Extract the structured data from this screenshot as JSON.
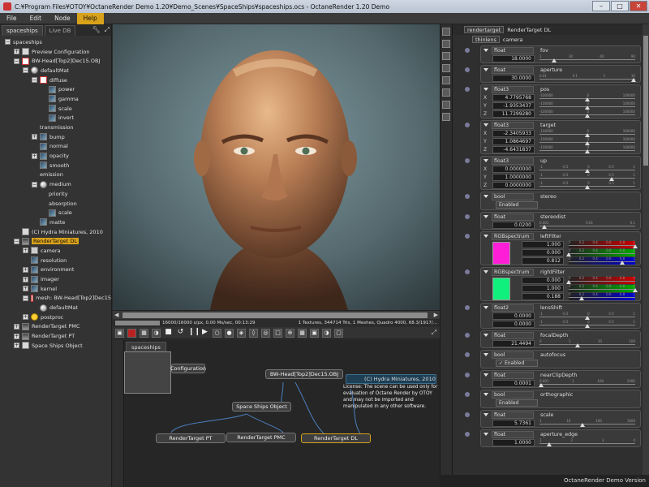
{
  "window": {
    "title": "C:¥Program Files¥OTOY¥OctaneRender Demo 1.20¥Demo_Scenes¥SpaceShips¥spaceships.ocs - OctaneRender 1.20 Demo",
    "minimize": "–",
    "maximize": "□",
    "close": "✕"
  },
  "menu": {
    "file": "File",
    "edit": "Edit",
    "node": "Node",
    "help": "Help"
  },
  "scene": {
    "tab_active": "spaceships",
    "tab_inactive": "Live DB",
    "tree": [
      {
        "label": "spaceships",
        "indent": 0,
        "exp": "-",
        "icon": "none"
      },
      {
        "label": "Preview Configuration",
        "indent": 1,
        "exp": "+",
        "icon": "doc"
      },
      {
        "label": "BW-Head[Top2]Dec15.OBJ",
        "indent": 1,
        "exp": "-",
        "icon": "red"
      },
      {
        "label": "defaultMat",
        "indent": 2,
        "exp": "-",
        "icon": "ball"
      },
      {
        "label": "diffuse",
        "indent": 3,
        "exp": "-",
        "icon": "red"
      },
      {
        "label": "power",
        "indent": 4,
        "exp": "",
        "icon": "tex"
      },
      {
        "label": "gamma",
        "indent": 4,
        "exp": "",
        "icon": "tex"
      },
      {
        "label": "scale",
        "indent": 4,
        "exp": "",
        "icon": "tex"
      },
      {
        "label": "invert",
        "indent": 4,
        "exp": "",
        "icon": "tex"
      },
      {
        "label": "transmission",
        "indent": 3,
        "exp": "",
        "icon": "none"
      },
      {
        "label": "bump",
        "indent": 3,
        "exp": "+",
        "icon": "tex"
      },
      {
        "label": "normal",
        "indent": 3,
        "exp": "",
        "icon": "tex"
      },
      {
        "label": "opacity",
        "indent": 3,
        "exp": "+",
        "icon": "tex"
      },
      {
        "label": "smooth",
        "indent": 3,
        "exp": "",
        "icon": "tex"
      },
      {
        "label": "emission",
        "indent": 3,
        "exp": "",
        "icon": "none"
      },
      {
        "label": "medium",
        "indent": 3,
        "exp": "-",
        "icon": "ball"
      },
      {
        "label": "priority",
        "indent": 4,
        "exp": "",
        "icon": "none"
      },
      {
        "label": "absorption",
        "indent": 4,
        "exp": "",
        "icon": "none"
      },
      {
        "label": "scale",
        "indent": 4,
        "exp": "",
        "icon": "tex"
      },
      {
        "label": "matte",
        "indent": 3,
        "exp": "",
        "icon": "tex"
      },
      {
        "label": "(C) Hydra Miniatures, 2010",
        "indent": 1,
        "exp": "",
        "icon": "doc"
      },
      {
        "label": "RenderTarget DL",
        "indent": 1,
        "exp": "-",
        "icon": "rt",
        "selected": true
      },
      {
        "label": "camera",
        "indent": 2,
        "exp": "+",
        "icon": "cam"
      },
      {
        "label": "resolution",
        "indent": 2,
        "exp": "",
        "icon": "tex"
      },
      {
        "label": "environment",
        "indent": 2,
        "exp": "+",
        "icon": "tex"
      },
      {
        "label": "imager",
        "indent": 2,
        "exp": "+",
        "icon": "tex"
      },
      {
        "label": "kernel",
        "indent": 2,
        "exp": "+",
        "icon": "tex"
      },
      {
        "label": "mesh: BW-Head[Top2]Dec15",
        "indent": 2,
        "exp": "-",
        "icon": "red"
      },
      {
        "label": "defaultMat",
        "indent": 3,
        "exp": "",
        "icon": "ball"
      },
      {
        "label": "postproc",
        "indent": 2,
        "exp": "+",
        "icon": "sun"
      },
      {
        "label": "RenderTarget PMC",
        "indent": 1,
        "exp": "+",
        "icon": "rt"
      },
      {
        "label": "RenderTarget PT",
        "indent": 1,
        "exp": "+",
        "icon": "rt"
      },
      {
        "label": "Space Ships Object",
        "indent": 1,
        "exp": "+",
        "icon": "doc"
      }
    ]
  },
  "status": {
    "samples": "16000/16000 s/px, 0.00 Ms/sec, 00:13:29",
    "info": "1 Textures, 344714 Tris, 1 Meshes, Quadro 4000, 68.3/1917/..."
  },
  "nodegraph": {
    "tab": "spaceships",
    "preview_config": "Configuration",
    "mesh": "BW-Head[Top2]Dec15.OBJ",
    "space_ships": "Space Ships Object",
    "rt_pt": "RenderTarget PT",
    "rt_pmc": "RenderTarget PMC",
    "rt_dl": "RenderTarget DL",
    "info_title": "(C) Hydra Miniatures, 2010",
    "info_text": "License: The scene can be used only for evaluation of Octane Render by OTOY and may not be imported and manipulated in any other software."
  },
  "inspector": {
    "head_type": "rendertarget",
    "head_name": "RenderTarget DL",
    "sub_type": "thinlens",
    "sub_name": "camera",
    "params": [
      {
        "type": "float",
        "name": "fov",
        "values": [
          "18.0000"
        ],
        "knobs": [
          0.15
        ],
        "ticks": [
          "1",
          "30",
          "60",
          "90"
        ]
      },
      {
        "type": "float",
        "name": "aperture",
        "values": [
          "30.0000"
        ],
        "knobs": [
          0.98
        ],
        "ticks": [
          "0.01",
          "0.1",
          "1",
          "10"
        ]
      },
      {
        "type": "float3",
        "name": "pos",
        "axes": [
          "X",
          "Y",
          "Z"
        ],
        "values": [
          "4.7795768",
          "-1.9353437",
          "11.7299280"
        ],
        "knobs": [
          0.5,
          0.5,
          0.5
        ],
        "ticks": [
          "-100000",
          "0",
          "100000"
        ]
      },
      {
        "type": "float3",
        "name": "target",
        "axes": [
          "X",
          "Y",
          "Z"
        ],
        "values": [
          "-2.3405933",
          "1.0864697",
          "-4.6431837"
        ],
        "knobs": [
          0.5,
          0.5,
          0.5
        ],
        "ticks": [
          "-100000",
          "0",
          "100000"
        ]
      },
      {
        "type": "float3",
        "name": "up",
        "axes": [
          "X",
          "Y",
          "Z"
        ],
        "values": [
          "0.0000000",
          "1.0000000",
          "0.0000000"
        ],
        "knobs": [
          0.5,
          0.75,
          0.5
        ],
        "ticks": [
          "-1",
          "-0.5",
          "0",
          "0.5",
          "1"
        ]
      },
      {
        "type": "bool",
        "name": "stereo",
        "check": "Enabled",
        "checked": false
      },
      {
        "type": "float",
        "name": "stereodist",
        "values": [
          "0.0200"
        ],
        "knobs": [
          0.05
        ],
        "ticks": [
          "0.001",
          "0.01",
          "0.1"
        ]
      },
      {
        "type": "RGBspectrum",
        "name": "leftFilter",
        "swatch": "#ff1ed8",
        "values": [
          "1.000",
          "0.000",
          "0.812"
        ],
        "knobs": [
          1.0,
          0.0,
          0.81
        ],
        "ticks": [
          "0",
          "0.2",
          "0.4",
          "0.6",
          "0.8",
          "1"
        ]
      },
      {
        "type": "RGBspectrum",
        "name": "rightFilter",
        "swatch": "#10f07c",
        "values": [
          "0.000",
          "1.000",
          "0.188"
        ],
        "knobs": [
          0.0,
          1.0,
          0.19
        ],
        "ticks": [
          "0",
          "0.2",
          "0.4",
          "0.6",
          "0.8",
          "1"
        ]
      },
      {
        "type": "float2",
        "name": "lensShift",
        "values": [
          "0.0000",
          "0.0000"
        ],
        "knobs": [
          0.5,
          0.5
        ],
        "ticks": [
          "-1",
          "-0.5",
          "0",
          "0.5",
          "1"
        ]
      },
      {
        "type": "float",
        "name": "focalDepth",
        "values": [
          "21.4494"
        ],
        "knobs": [
          0.4
        ],
        "ticks": [
          "0",
          "1",
          "10",
          "100"
        ]
      },
      {
        "type": "bool",
        "name": "autofocus",
        "check": "Enabled",
        "checked": true
      },
      {
        "type": "float",
        "name": "nearClipDepth",
        "values": [
          "0.0001"
        ],
        "knobs": [
          0.02
        ],
        "ticks": [
          "0.001",
          "1",
          "100",
          "1000"
        ]
      },
      {
        "type": "bool",
        "name": "orthographic",
        "check": "Enabled",
        "checked": false
      },
      {
        "type": "float",
        "name": "scale",
        "values": [
          "5.7361"
        ],
        "knobs": [
          0.45
        ],
        "ticks": [
          "1",
          "10",
          "100",
          "1000"
        ]
      },
      {
        "type": "float",
        "name": "aperture_edge",
        "values": [
          "1.0000"
        ],
        "knobs": [
          0.1
        ],
        "ticks": [
          "1",
          "2",
          "3",
          "4"
        ]
      }
    ]
  },
  "footer": "OctaneRender Demo Version",
  "colors": {
    "accent": "#d9a21b",
    "panel": "#333333",
    "viewport_bg": "#5a6a6f"
  },
  "render_alt": "3D rendered portrait of a bald man's head"
}
